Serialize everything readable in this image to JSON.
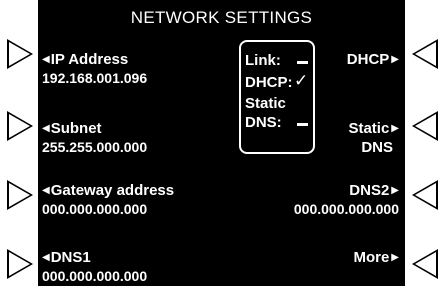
{
  "title": "NETWORK SETTINGS",
  "left_fields": [
    {
      "label": "IP Address",
      "value": "192.168.001.096"
    },
    {
      "label": "Subnet",
      "value": "255.255.000.000"
    },
    {
      "label": "Gateway address",
      "value": "000.000.000.000"
    },
    {
      "label": "DNS1",
      "value": "000.000.000.000"
    }
  ],
  "right_fields": [
    {
      "label": "DHCP",
      "value": ""
    },
    {
      "label": "Static",
      "value": "DNS"
    },
    {
      "label": "DNS2",
      "value": "000.000.000.000"
    },
    {
      "label": "More",
      "value": ""
    }
  ],
  "status": {
    "link_label": "Link:",
    "dhcp_label": "DHCP:",
    "dhcp_check": "✓",
    "static_label": "Static",
    "dns_label": "DNS:"
  },
  "arrows": {
    "left": "◀",
    "right": "▶"
  }
}
